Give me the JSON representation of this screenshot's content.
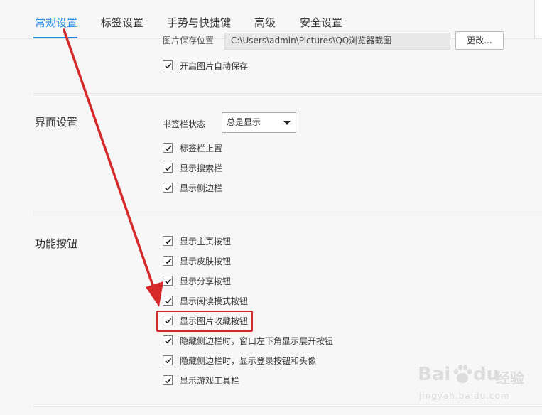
{
  "tabs": [
    {
      "label": "常规设置",
      "active": true
    },
    {
      "label": "标签设置",
      "active": false
    },
    {
      "label": "手势与快捷键",
      "active": false
    },
    {
      "label": "高级",
      "active": false
    },
    {
      "label": "安全设置",
      "active": false
    }
  ],
  "image_save": {
    "label": "图片保存位置",
    "path": "C:\\Users\\admin\\Pictures\\QQ浏览器截图",
    "change_button": "更改...",
    "auto_save": {
      "label": "开启图片自动保存",
      "checked": true
    }
  },
  "interface": {
    "title": "界面设置",
    "bookmark_bar_label": "书签栏状态",
    "bookmark_bar_value": "总是显示",
    "options": [
      {
        "label": "标签栏上置",
        "checked": true
      },
      {
        "label": "显示搜索栏",
        "checked": true
      },
      {
        "label": "显示侧边栏",
        "checked": true
      }
    ]
  },
  "functions": {
    "title": "功能按钮",
    "options": [
      {
        "label": "显示主页按钮",
        "checked": true
      },
      {
        "label": "显示皮肤按钮",
        "checked": true
      },
      {
        "label": "显示分享按钮",
        "checked": true
      },
      {
        "label": "显示阅读模式按钮",
        "checked": true
      },
      {
        "label": "显示图片收藏按钮",
        "checked": true
      },
      {
        "label": "隐藏侧边栏时，窗口左下角显示展开按钮",
        "checked": true
      },
      {
        "label": "隐藏侧边栏时，显示登录按钮和头像",
        "checked": true
      },
      {
        "label": "显示游戏工具栏",
        "checked": true
      }
    ]
  },
  "watermark": {
    "brand": "Bai",
    "brand2": "du",
    "site": "经验",
    "url": "jingyan.baidu.com"
  },
  "colors": {
    "accent": "#1e88e5",
    "annotation": "#d62a2a"
  }
}
